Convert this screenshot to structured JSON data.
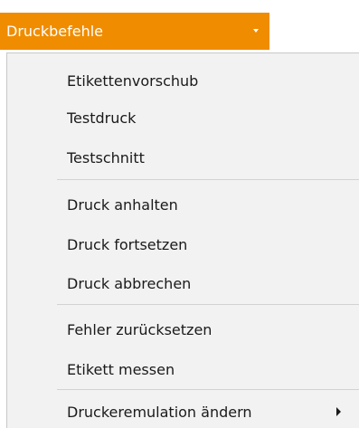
{
  "menu_button": {
    "label": "Druckbefehle",
    "color": "#f08c00",
    "icon": "chevron-down-icon"
  },
  "items": [
    {
      "label": "Etikettenvorschub"
    },
    {
      "label": "Testdruck"
    },
    {
      "label": "Testschnitt"
    },
    {
      "label": "Druck anhalten"
    },
    {
      "label": "Druck fortsetzen"
    },
    {
      "label": "Druck abbrechen"
    },
    {
      "label": "Fehler zurücksetzen"
    },
    {
      "label": "Etikett messen"
    },
    {
      "label": "Druckeremulation ändern",
      "submenu_icon": "chevron-right-icon"
    }
  ]
}
